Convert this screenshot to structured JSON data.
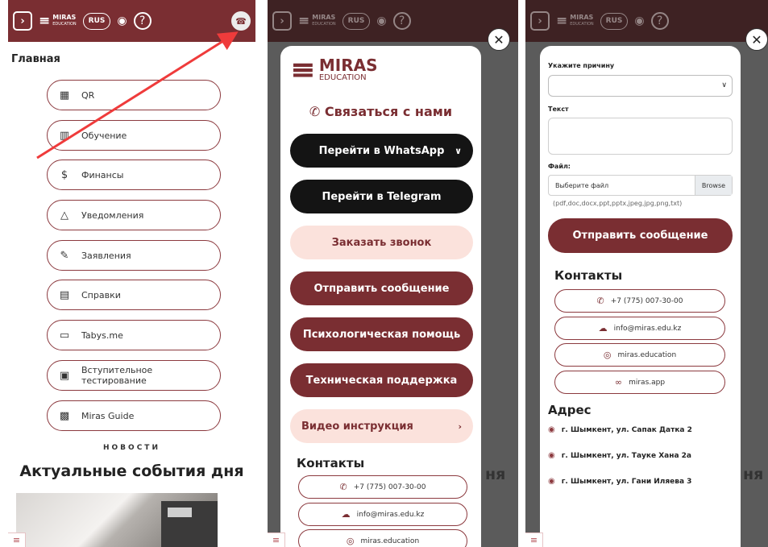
{
  "topbar": {
    "menu_icon": "chevron-right-icon",
    "logo_text": "MIRAS",
    "logo_sub": "EDUCATION",
    "lang": "RUS",
    "help": "?"
  },
  "panel1": {
    "title": "Главная",
    "menu": [
      {
        "label": "QR",
        "icon": "qr-icon"
      },
      {
        "label": "Обучение",
        "icon": "book-icon"
      },
      {
        "label": "Финансы",
        "icon": "dollar-icon"
      },
      {
        "label": "Уведомления",
        "icon": "bell-icon"
      },
      {
        "label": "Заявления",
        "icon": "pen-icon"
      },
      {
        "label": "Справки",
        "icon": "clipboard-icon"
      },
      {
        "label": "Tabys.me",
        "icon": "wallet-icon"
      },
      {
        "label": "Вступительное тестирование",
        "icon": "test-icon"
      },
      {
        "label": "Miras Guide",
        "icon": "guide-icon"
      }
    ],
    "news_label": "НОВОСТИ",
    "news_title": "Актуальные события дня"
  },
  "panel2": {
    "logo_text": "MIRAS",
    "logo_sub": "EDUCATION",
    "contact_title": "Связаться с нами",
    "buttons": {
      "whatsapp": "Перейти в WhatsApp",
      "telegram": "Перейти в Telegram",
      "call": "Заказать звонок",
      "message": "Отправить сообщение",
      "psych": "Психологическая помощь",
      "support": "Техническая поддержка",
      "video": "Видео инструкция"
    },
    "contacts_title": "Контакты",
    "backdrop_text": "ня"
  },
  "panel3": {
    "reason_label": "Укажите причину",
    "text_label": "Текст",
    "file_label": "Файл:",
    "file_placeholder": "Выберите файл",
    "browse": "Browse",
    "file_hint": "(pdf,doc,docx,ppt,pptx,jpeg,jpg,png,txt)",
    "submit": "Отправить сообщение",
    "contacts_title": "Контакты",
    "address_title": "Адрес",
    "addresses": [
      "г. Шымкент, ул. Сапак Датка 2",
      "г. Шымкент, ул. Тауке Хана 2а",
      "г. Шымкент, ул. Гани Иляева 3"
    ],
    "backdrop_text": "ня"
  },
  "contacts": {
    "phone": "+7 (775) 007-30-00",
    "email": "info@miras.edu.kz",
    "instagram": "miras.education",
    "site": "miras.app"
  },
  "colors": {
    "brand": "#7a2e32",
    "pink": "#fbe2dc",
    "black": "#141414"
  }
}
